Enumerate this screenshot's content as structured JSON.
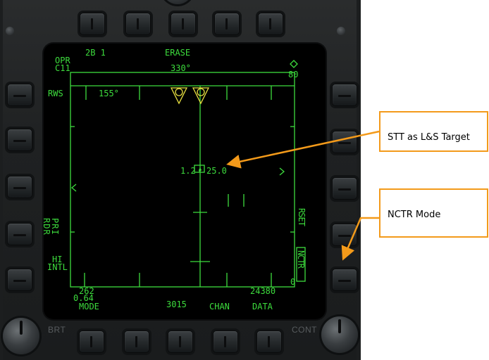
{
  "display": {
    "top_left_row1": "2B 1",
    "opr": "OPR",
    "c11": "C11",
    "erase": "ERASE",
    "azimuth_readout": "330°",
    "range_scale": "80",
    "range_min": "0",
    "rws": "RWS",
    "aspect_readout": "155°",
    "target_left_value": "1.2",
    "target_right_value": "25.0",
    "rdr": "RDR",
    "pri": "PRI",
    "hi": "HI",
    "intl": "INTL",
    "rset": "RSET",
    "nctr": "NCTR",
    "speed_value": "262",
    "mach_value": "0.64",
    "mode": "MODE",
    "code_3015": "3015",
    "chan": "CHAN",
    "data": "DATA",
    "altitude_value": "24380"
  },
  "bezel": {
    "brt": "BRT",
    "cont": "CONT"
  },
  "annotations": {
    "stt_label": "STT as L&S Target",
    "nctr_label": "NCTR Mode"
  },
  "colors": {
    "display_green": "#3ddc3d",
    "target_yellow": "#e8e040",
    "callout_orange": "#f39a1a"
  }
}
